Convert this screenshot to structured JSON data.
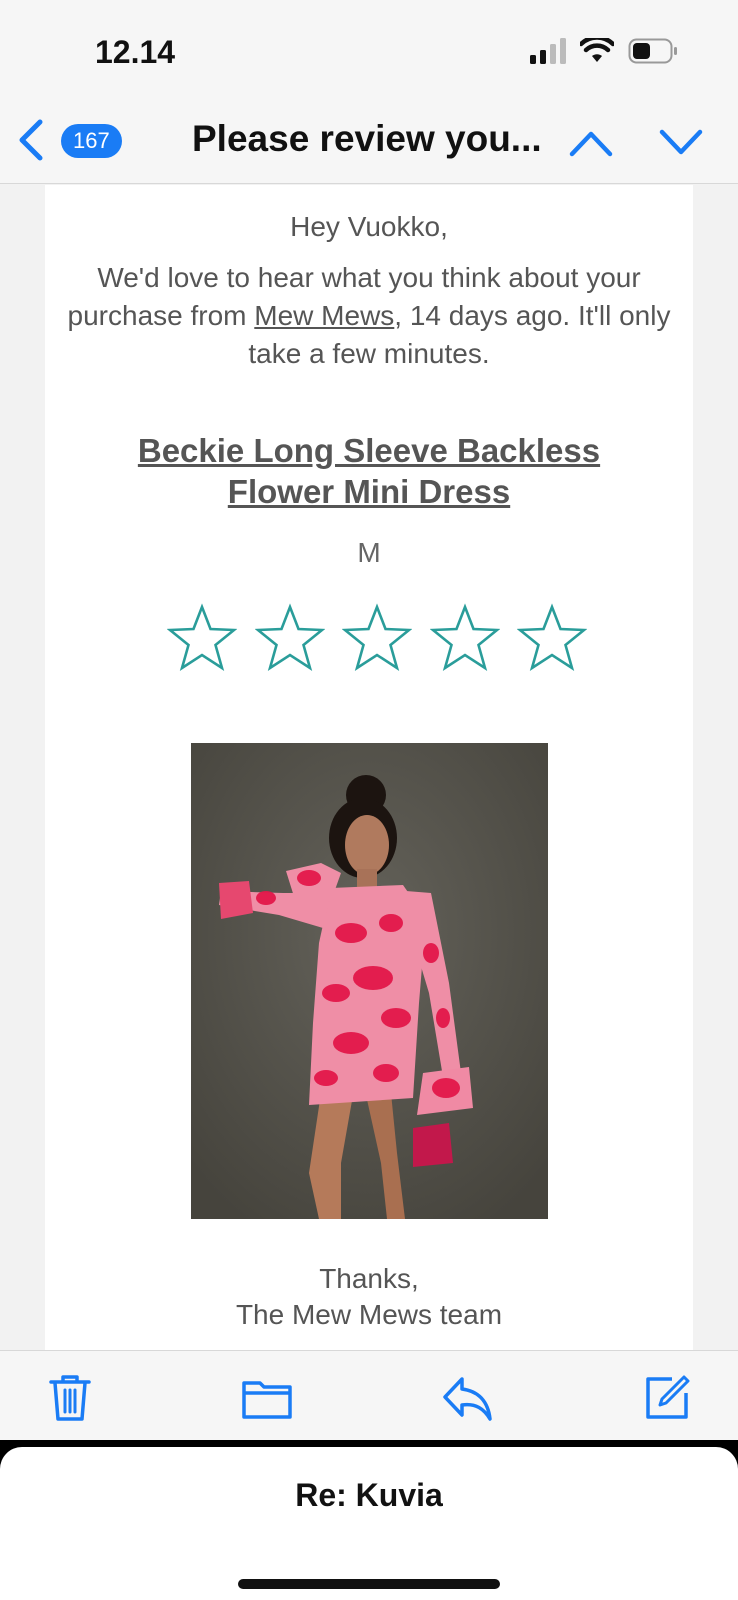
{
  "status_bar": {
    "time": "12.14",
    "icons": [
      "cellular-signal-icon",
      "wifi-icon",
      "battery-icon"
    ]
  },
  "nav": {
    "unread_count": "167",
    "title": "Please review you...",
    "icons": [
      "chevron-left-icon",
      "chevron-up-icon",
      "chevron-down-icon"
    ]
  },
  "email": {
    "greeting": "Hey Vuokko,",
    "intro_before": "We'd love to hear what you think about your purchase from ",
    "shop_link": "Mew Mews",
    "intro_after": ", 14 days ago. It'll only take a few minutes.",
    "product_name": "Beckie Long Sleeve Backless Flower Mini Dress",
    "product_size": "M",
    "rating": {
      "max_stars": 5,
      "selected": 0
    },
    "signoff_line1": "Thanks,",
    "signoff_line2": "The Mew Mews team"
  },
  "toolbar": {
    "icons": [
      "trash-icon",
      "folder-icon",
      "reply-icon",
      "compose-icon"
    ]
  },
  "draft": {
    "title": "Re: Kuvia"
  },
  "colors": {
    "accent": "#1a7cf5",
    "star": "#2a9d9a",
    "text": "#555555"
  }
}
